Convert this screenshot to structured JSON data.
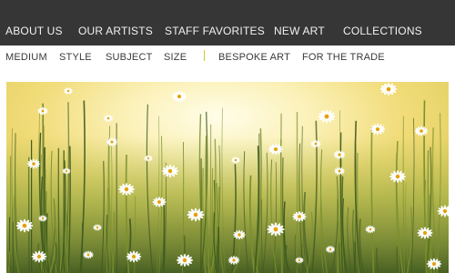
{
  "top_nav": {
    "items": [
      {
        "label": "ABOUT US"
      },
      {
        "label": "OUR ARTISTS"
      },
      {
        "label": "STAFF FAVORITES"
      },
      {
        "label": "NEW ART"
      },
      {
        "label": "COLLECTIONS"
      }
    ]
  },
  "sub_nav": {
    "items": [
      {
        "label": "MEDIUM"
      },
      {
        "label": "STYLE"
      },
      {
        "label": "SUBJECT"
      },
      {
        "label": "SIZE"
      },
      {
        "label": "BESPOKE ART"
      },
      {
        "label": "FOR THE TRADE"
      }
    ]
  },
  "hero": {
    "subject": "daisies painting",
    "colors": {
      "sky_light": "#fffbe0",
      "sky_yellow": "#f4e27a",
      "grass_dark": "#3f5a1f",
      "grass_mid": "#7a8f2e",
      "petal": "#ffffff",
      "center": "#e6a000"
    }
  }
}
